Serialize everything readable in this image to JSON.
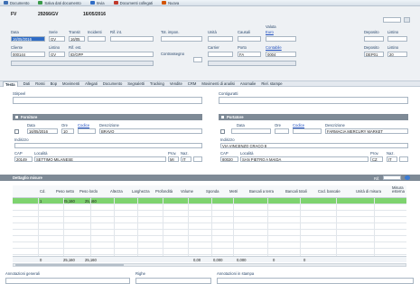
{
  "toolbar": {
    "items": [
      {
        "label": "Documento",
        "color": "#3d6fb3",
        "icon": "document-icon"
      },
      {
        "label": "Salva dati documento",
        "color": "#3a9a4a",
        "icon": "save-icon"
      },
      {
        "label": "Invia",
        "color": "#2f6cc5",
        "icon": "send-icon"
      },
      {
        "label": "Documenti collegati",
        "color": "#c0392b",
        "icon": "link-icon"
      },
      {
        "label": "Nuova",
        "color": "#d35400",
        "icon": "new-icon"
      }
    ]
  },
  "header": {
    "type_code": "FV",
    "doc_number": "29266/GV",
    "doc_date": "16/05/2016",
    "labels": {
      "data": "Data",
      "serie": "Serie",
      "transiti": "Transit",
      "incidenti": "Incidenti",
      "rif_int": "Rif. int.",
      "tot_impon": "Tot. impon.",
      "unita": "Unità",
      "causali": "Causali",
      "valuta": "Valuta",
      "deposito": "Deposito",
      "listino": "Listino",
      "cliente": "Cliente",
      "rif_est": "Rif. est.",
      "contrassegno": "Contrassegno",
      "carrier": "Carrier",
      "porto": "Porto",
      "contabile": "Contabile"
    },
    "values": {
      "data": "16/05/2016",
      "serie": "GV",
      "transito": "16/05",
      "cliente": "000144",
      "listino": "GV",
      "rif_est": "ID/GPP",
      "valuta": "Euro",
      "porto": "FA",
      "contabile": "0004",
      "deposito": "DEP01",
      "listino_right": "20"
    }
  },
  "tabs": [
    "Testa",
    "Dati",
    "Rossi",
    "Bop",
    "Movimenti",
    "Allegati",
    "Documento",
    "Segnaletti",
    "Tracking",
    "Vendite",
    "CRM",
    "Movimenti di analisi",
    "Anomalie",
    "Riel. stampe"
  ],
  "notes": {
    "left_label": "Stirpeel",
    "right_label": "Contiguratti"
  },
  "fornitori": {
    "left_title": "Fornitore",
    "right_title": "Portatore",
    "col_data": "Data",
    "col_ore": "Ore",
    "col_codice": "Codice",
    "col_descrizione": "Descrizione",
    "left_data": "16/05/2016",
    "left_ore": "10",
    "left_descrizione": "BRAVO",
    "right_descrizione": "FARMACIA MERCURY MARKET",
    "indirizzo_label": "Indirizzo",
    "left_indirizzo": "",
    "right_indirizzo": "VIA VINCENZO CRACO 8",
    "cap_label": "CAP",
    "localita_label": "Località",
    "prov_label": "Prov.",
    "naz_label": "Naz.",
    "left_cap": "20149",
    "left_localita": "SETTIMO MILANESE",
    "left_prov": "MI",
    "left_naz": "IT",
    "right_cap": "80020",
    "right_localita": "SAN PIETRO A MAIDA",
    "right_prov": "CZ",
    "right_naz": "IT"
  },
  "grid": {
    "section_title": "Dettaglio misure",
    "rif_label": "Rif.",
    "columns": [
      "Cd.",
      "Peso netto",
      "Peso lordo",
      "Altezza",
      "Larghezza",
      "Profondità",
      "Volume",
      "Sponda",
      "Metri",
      "Bancali a terra",
      "Bancali totali",
      "Cod. bancale",
      "Unità di misura",
      "Misura esterna"
    ],
    "rows": [
      {
        "cd": "1",
        "peso_netto": "25,160",
        "peso_lordo": "25,160",
        "highlight": true
      },
      {
        "cd": "",
        "peso_netto": "",
        "peso_lordo": "",
        "highlight": false
      },
      {
        "cd": "",
        "peso_netto": "",
        "peso_lordo": "",
        "highlight": false
      },
      {
        "cd": "",
        "peso_netto": "",
        "peso_lordo": "",
        "highlight": false
      },
      {
        "cd": "",
        "peso_netto": "",
        "peso_lordo": "",
        "highlight": false
      },
      {
        "cd": "",
        "peso_netto": "",
        "peso_lordo": "",
        "highlight": false
      },
      {
        "cd": "",
        "peso_netto": "",
        "peso_lordo": "",
        "highlight": false
      },
      {
        "cd": "",
        "peso_netto": "",
        "peso_lordo": "",
        "highlight": false
      },
      {
        "cd": "",
        "peso_netto": "",
        "peso_lordo": "",
        "highlight": false
      }
    ],
    "totals": {
      "cd": "0",
      "peso_netto": "25,160",
      "peso_lordo": "25,160",
      "volume": "0,00",
      "sponda": "0,000",
      "metri": "0,000",
      "bancali_terra": "0",
      "bancali_tot": "0"
    }
  },
  "footer": {
    "annotazioni_generali": "Annotazioni generali",
    "righe": "Righe",
    "annotazioni_stampa": "Annotazioni in stampa"
  }
}
